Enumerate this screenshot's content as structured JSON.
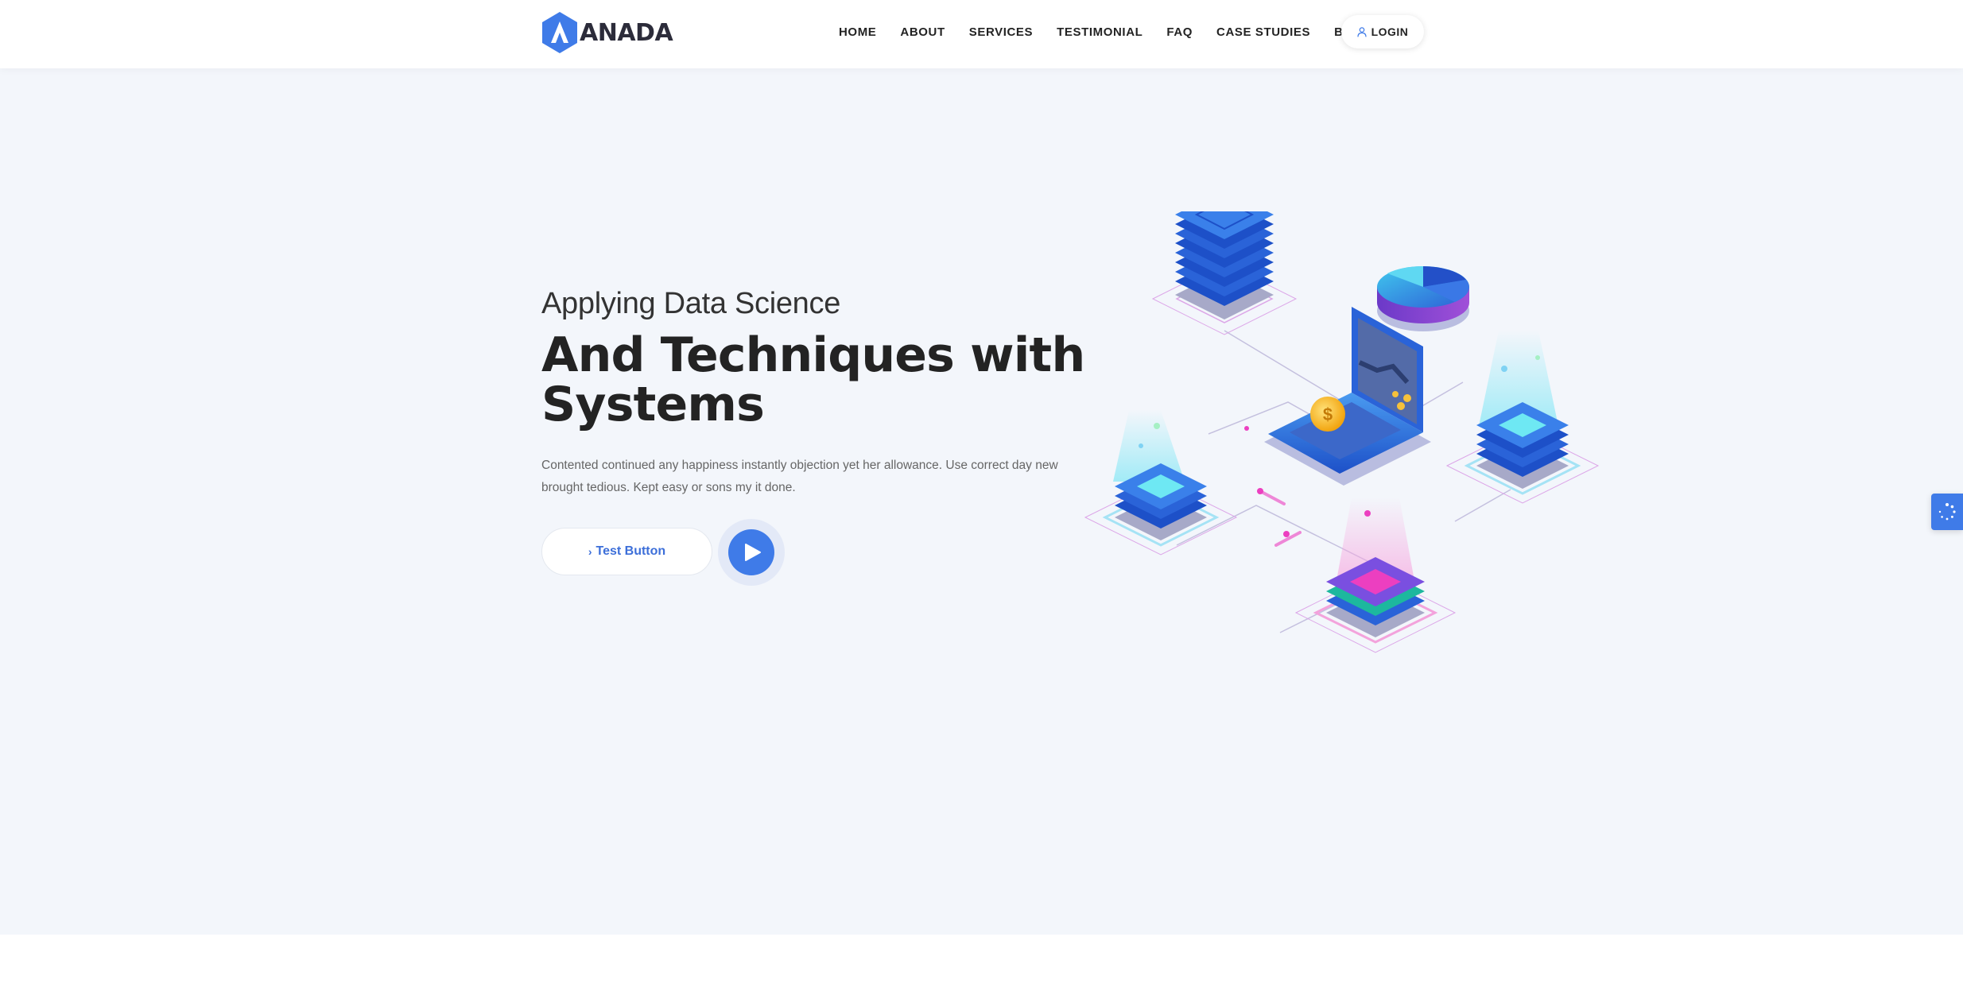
{
  "brand": {
    "name": "ANADA",
    "accent": "#3f7be8"
  },
  "nav": {
    "items": [
      {
        "label": "HOME"
      },
      {
        "label": "ABOUT"
      },
      {
        "label": "SERVICES"
      },
      {
        "label": "TESTIMONIAL"
      },
      {
        "label": "FAQ"
      },
      {
        "label": "CASE STUDIES"
      },
      {
        "label": "BLOG"
      }
    ],
    "login_label": "LOGIN",
    "login_icon": "user-icon"
  },
  "hero": {
    "subtitle": "Applying Data Science",
    "title": "And Techniques with Systems",
    "description": "Contented continued any happiness instantly objection yet her allowance. Use correct day new brought tedious. Kept easy or sons my it done.",
    "cta_label": "Test Button",
    "cta_icon": "chevron-right-icon",
    "play_icon": "play-icon",
    "background": "#f3f6fb"
  },
  "side_widget": {
    "icon": "settings-spinner-icon"
  }
}
